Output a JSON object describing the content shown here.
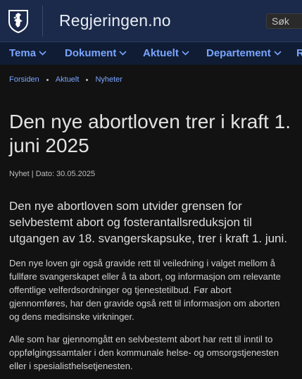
{
  "header": {
    "site_title": "Regjeringen.no",
    "search_label": "Søk"
  },
  "nav": {
    "items": [
      {
        "label": "Tema"
      },
      {
        "label": "Dokument"
      },
      {
        "label": "Aktuelt"
      },
      {
        "label": "Departement"
      },
      {
        "label": "R"
      }
    ]
  },
  "breadcrumb": [
    "Forsiden",
    "Aktuelt",
    "Nyheter"
  ],
  "article": {
    "title": "Den nye abortloven trer i kraft 1. juni 2025",
    "meta": "Nyhet | Dato: 30.05.2025",
    "lead": "Den nye abortloven som utvider grensen for selvbestemt abort og fosterantallsreduksjon til utgangen av 18. svangerskapsuke, trer i kraft 1. juni.",
    "paragraphs": [
      "Den nye loven gir også gravide rett til veiledning i valget mellom å fullføre svangerskapet eller å ta abort, og informasjon om relevante offentlige velferdsordninger og tjenestetilbud. Før abort gjennomføres, har den gravide også rett til informasjon om aborten og dens medisinske virkninger.",
      "Alle som har gjennomgått en selvbestemt abort har rett til inntil to oppfølgingssamtaler i den kommunale helse- og omsorgstjenesten eller i spesialisthelsetjenesten."
    ]
  },
  "colors": {
    "header_bg": "#1b2a4a",
    "nav_bg": "#0f1c33",
    "page_bg": "#121212",
    "link": "#7aa5ff"
  }
}
